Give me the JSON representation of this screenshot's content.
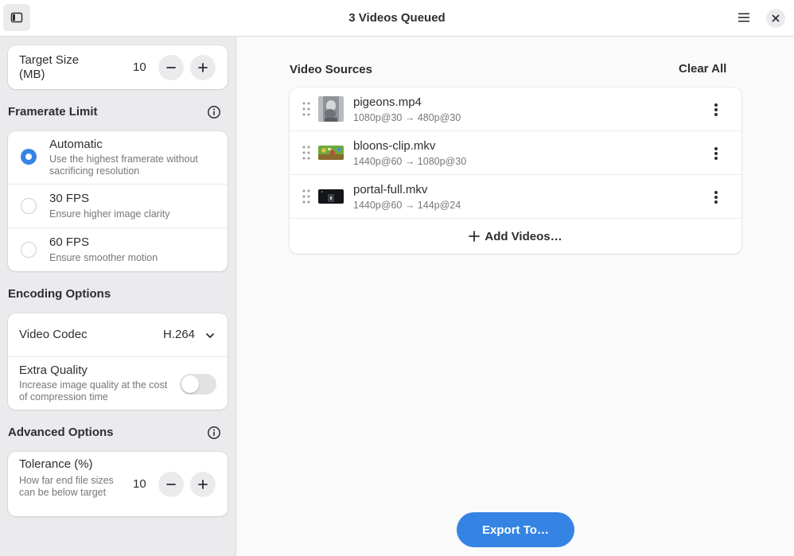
{
  "header": {
    "title": "3 Videos Queued",
    "icons": {
      "sidebar_toggle": "sidebar-toggle-icon",
      "menu": "hamburger-menu-icon",
      "close": "close-icon"
    }
  },
  "sidebar": {
    "target_size": {
      "label": "Target Size (MB)",
      "value": "10"
    },
    "framerate": {
      "title": "Framerate Limit",
      "options": [
        {
          "label": "Automatic",
          "description": "Use the highest framerate without sacrificing resolution",
          "selected": true
        },
        {
          "label": "30 FPS",
          "description": "Ensure higher image clarity",
          "selected": false
        },
        {
          "label": "60 FPS",
          "description": "Ensure smoother motion",
          "selected": false
        }
      ]
    },
    "encoding": {
      "title": "Encoding Options",
      "codec_label": "Video Codec",
      "codec_value": "H.264",
      "extra_quality_label": "Extra Quality",
      "extra_quality_description": "Increase image quality at the cost of compression time",
      "extra_quality_enabled": false
    },
    "advanced": {
      "title": "Advanced Options",
      "tolerance_label": "Tolerance (%)",
      "tolerance_description": "How far end file sizes can be below target",
      "tolerance_value": "10"
    }
  },
  "main": {
    "sources_title": "Video Sources",
    "clear_all_label": "Clear All",
    "videos": [
      {
        "name": "pigeons.mp4",
        "info": "1080p@30 → 480p@30"
      },
      {
        "name": "bloons-clip.mkv",
        "info": "1440p@60 → 1080p@30"
      },
      {
        "name": "portal-full.mkv",
        "info": "1440p@60 → 144p@24"
      }
    ],
    "add_videos_label": "Add Videos…",
    "export_label": "Export To…"
  },
  "colors": {
    "accent": "#3584e4",
    "sidebar_bg": "#ebebed",
    "main_bg": "#fafafb"
  }
}
